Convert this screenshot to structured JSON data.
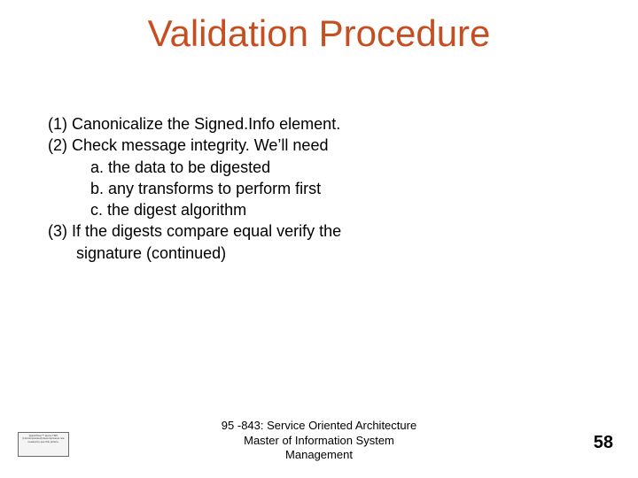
{
  "title": "Validation Procedure",
  "body": {
    "l1": "(1) Canonicalize the Signed.Info element.",
    "l2": "(2) Check message integrity. We’ll need",
    "l2a": "a. the data to be digested",
    "l2b": "b. any transforms to perform first",
    "l2c": "c. the digest algorithm",
    "l3a": "(3) If the digests compare equal verify the",
    "l3b": "signature (continued)"
  },
  "footer": {
    "course": "95 -843: Service Oriented Architecture",
    "sub1": "Master of Information System",
    "sub2": "Management"
  },
  "placeholder_text": "QuickTime™ and a TIFF (Uncompressed) decompressor are needed to see this picture.",
  "page_number": "58"
}
